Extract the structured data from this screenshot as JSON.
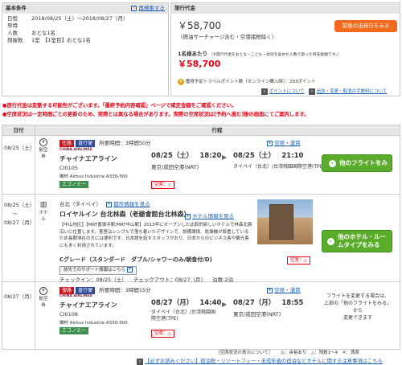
{
  "basic": {
    "header": "基本条件",
    "rebook_link": "再検索する",
    "rows": [
      {
        "label": "日程",
        "value": "2018/08/25（土）〜2018/08/27（月）"
      },
      {
        "label": "早特",
        "value": ""
      },
      {
        "label": "人数",
        "value": "おとな1名"
      },
      {
        "label": "部屋数",
        "value": "1室　【1室目】おとな1名"
      }
    ]
  },
  "price": {
    "header": "旅行代金",
    "total": "￥58,700",
    "total_note": "（燃油サーチャージ含む・空港諸税除く）",
    "change_date_button": "前後の出発日をみる",
    "per_person_label": "1名様あたり",
    "per_person_note": "（※旅行代金をおとな・こども・幼児を含めた人数で割った目安金額です。）",
    "per_person": "￥58,700",
    "points_text": "獲得予定トラベルポイント数（オンライン購入時）：293ポイント",
    "points_link": "ポイントについて",
    "fees_link": "追加・変更・取消の手数料について"
  },
  "notices": [
    "旅行代金は変動する可能性がございます。「最終予約内容確認」ページで確定金額をご確認ください。",
    "空席状況は一定時間ごとの更新のため、実際とは異なる場合があります。実際の空席状況は[予約へ進む]後の画面にてご案内します。"
  ],
  "table": {
    "col_date": "日付",
    "col_itinerary": "行程"
  },
  "legs": [
    {
      "date": "08/25（土）",
      "kind": "航空券",
      "tag1": "往路",
      "tag2": "直行便",
      "duration": "所要時間：3時間50分",
      "detail_link": "空席・運賃",
      "airline_logo": "CHINA AIRLINES",
      "airline": "チャイナエアライン",
      "flight": "CI0105",
      "aircraft": "機材 Airbus Industrie A330-300",
      "cabin": "エコノミー",
      "dep_date": "08/25（土）",
      "dep_time": "18:20",
      "dep_airport": "東京/成田空港(NRT)",
      "arr_date": "08/25（土）",
      "arr_time": "21:10",
      "arr_airport": "タイペイ（台北）/台湾桃園国際空港(TPE)",
      "seat": "空席：△",
      "button": "他のフライトをみる"
    },
    {
      "date": "08/27（月）",
      "kind": "航空券",
      "tag1": "復路",
      "tag2": "直行便",
      "duration": "所要時間：3時間15分",
      "detail_link": "空席・運賃",
      "airline_logo": "CHINA AIRLINES",
      "airline": "チャイナエアライン",
      "flight": "CI0108",
      "aircraft": "機材 Airbus Industrie A330-300",
      "cabin": "エコノミー",
      "dep_date": "08/27（月）",
      "dep_time": "14:40",
      "dep_airport": "タイペイ（台北）/台湾桃園国際空港(TPE)",
      "arr_date": "08/27（月）",
      "arr_time": "18:55",
      "arr_airport": "東京/成田空港(NRT)",
      "seat": "空席：△",
      "note_lines": [
        "フライトを変更する場合は、",
        "上部の「他のフライトをみる」",
        "から",
        "変更できます"
      ]
    }
  ],
  "hotel": {
    "date_from": "08/25（土）",
    "date_sep": "〜",
    "date_to": "08/27（月）",
    "kind": "ホテル",
    "area": "台北（タイペイ）",
    "area_link": "都市情報を見る",
    "name": "ロイヤルイン 台北林森（老爺會館台北林森）",
    "info_link": "ホテル情報を見る",
    "description": "【中山地区】【MRT善導寺駅/MRT中山駅】2013年にオープンした比較的新しいホテルで林森北路沿いに位置します。客室はシンプルで落ち着いたデザインで、設備環境、乾燥機が設置しているため長期滞在の方には便利です。日本語を話すスタッフがおり、日本からのビジネス客や観光客にも多く利用されています。",
    "room": "Cグレード（スタンダード　ダブル/シャワーのみ/朝食付/D)",
    "support_link": "旅先でのサポート情報はこちら",
    "checkin": "チェックイン：08/25（土）",
    "checkout": "チェックアウト：08/27（月）",
    "nights": "泊数:2泊",
    "vacancy": "空室：△",
    "button": "他のホテル・ルームタイプをみる"
  },
  "footer": {
    "legend_title": "［空席状況の表示について］",
    "legend": "◎：余裕あり　△：残数1〜4　✕：満席",
    "bottom_link": "【必ずお読みください】宿泊税・リゾートフィー・未成年者の宿泊などホテルに関する注意事項はこちら"
  },
  "colors": {
    "accent_red": "#e60012",
    "button_orange": "#f26b1d",
    "button_green": "#5aac2a",
    "tag_red": "#c8161e",
    "tag_blue": "#2b4a9c"
  }
}
